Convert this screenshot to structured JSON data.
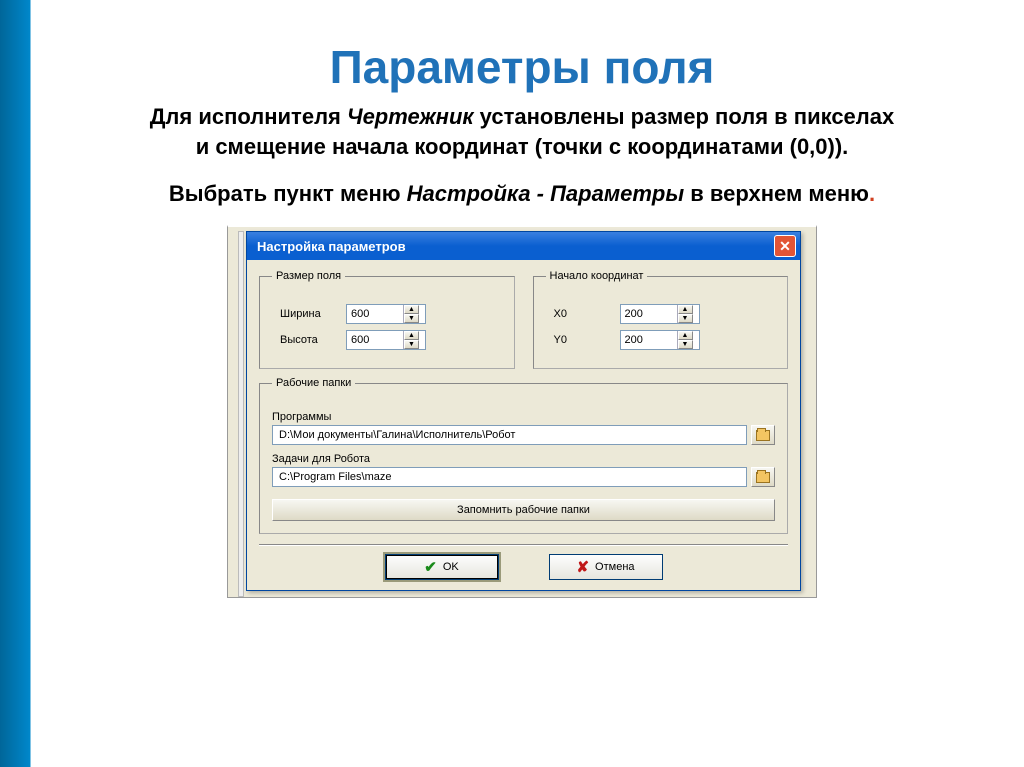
{
  "slide": {
    "title": "Параметры поля",
    "desc_line1_a": "Для исполнителя ",
    "desc_line1_em": "Чертежник",
    "desc_line1_b": "  установлены размер поля в пикселах",
    "desc_line2": "и смещение начала координат (точки с координатами (0,0)).",
    "instr_a": "Выбрать пункт меню ",
    "instr_em": "Настройка - Параметры",
    "instr_b": " в верхнем меню",
    "instr_dot": "."
  },
  "dialog": {
    "title": "Настройка параметров",
    "group_size": "Размер поля",
    "group_origin": "Начало координат",
    "width_label": "Ширина",
    "height_label": "Высота",
    "x0_label": "X0",
    "y0_label": "Y0",
    "width_val": "600",
    "height_val": "600",
    "x0_val": "200",
    "y0_val": "200",
    "group_folders": "Рабочие папки",
    "programs_label": "Программы",
    "programs_path": "D:\\Мои документы\\Галина\\Исполнитель\\Робот",
    "tasks_label": "Задачи для Робота",
    "tasks_path": "C:\\Program Files\\maze",
    "remember_btn": "Запомнить рабочие папки",
    "ok": "OK",
    "cancel": "Отмена"
  }
}
